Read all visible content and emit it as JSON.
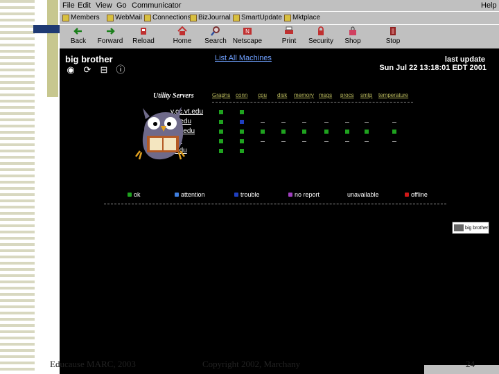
{
  "menu": {
    "items": [
      "File",
      "Edit",
      "View",
      "Go",
      "Communicator"
    ],
    "help": "Help"
  },
  "personal_bar": [
    "Members",
    "WebMail",
    "Connections",
    "BizJournal",
    "SmartUpdate",
    "Mktplace"
  ],
  "toolbar": [
    "Back",
    "Forward",
    "Reload",
    "Home",
    "Search",
    "Netscape",
    "Print",
    "Security",
    "Shop",
    "Stop"
  ],
  "page": {
    "logo": "big brother",
    "list_link": "List All Machines",
    "last_update_label": "last update",
    "last_update_time": "Sun Jul 22 13:18:01 EDT 2001",
    "utility_title": "Utility Servers",
    "columns": [
      "Graphs",
      "conn",
      "cpu",
      "disk",
      "memory",
      "msgs",
      "procs",
      "smtp",
      "temperature"
    ],
    "hosts": [
      "y.cc.vt.edu",
      ".vt.edu",
      "c.vt.edu",
      "edu",
      "y.edu"
    ],
    "legend": [
      "ok",
      "attention",
      "trouble",
      "no report",
      "unavailable",
      "offline"
    ],
    "badge": "big brother"
  },
  "status_rows": [
    [
      "green",
      "green",
      "none",
      "none",
      "none",
      "none",
      "none",
      "none",
      "none"
    ],
    [
      "green",
      "blue",
      "gray",
      "gray",
      "gray",
      "gray",
      "gray",
      "gray",
      "gray"
    ],
    [
      "green",
      "green",
      "green",
      "green",
      "green",
      "green",
      "green",
      "green",
      "green"
    ],
    [
      "green",
      "green",
      "gray",
      "gray",
      "gray",
      "gray",
      "gray",
      "gray",
      "gray"
    ],
    [
      "green",
      "green",
      "none",
      "none",
      "none",
      "none",
      "none",
      "none",
      "none"
    ]
  ],
  "colors": {
    "green": "#1fa31f",
    "blue": "#1f3fc0",
    "gray": "#aaaaaa",
    "purple": "#a03fbf",
    "red": "#d01818",
    "link": "#6fa0ff"
  },
  "footer": {
    "left": "Educause MARC, 2003",
    "mid": "Copyright 2002, Marchany",
    "page": "24"
  }
}
